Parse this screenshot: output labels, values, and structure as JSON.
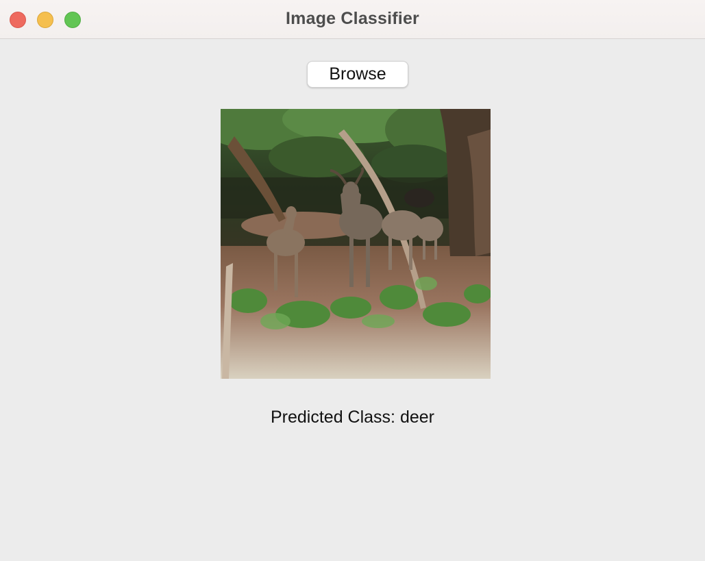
{
  "window": {
    "title": "Image Classifier"
  },
  "toolbar": {
    "browse_label": "Browse"
  },
  "image": {
    "subject": "deer-in-forest-photo"
  },
  "result": {
    "prediction_label": "Predicted Class: deer"
  },
  "colors": {
    "window_bg": "#ececec",
    "titlebar_bg": "#f5f1f0",
    "close": "#ee6a5f",
    "minimize": "#f5bf4f",
    "maximize": "#62c554"
  }
}
